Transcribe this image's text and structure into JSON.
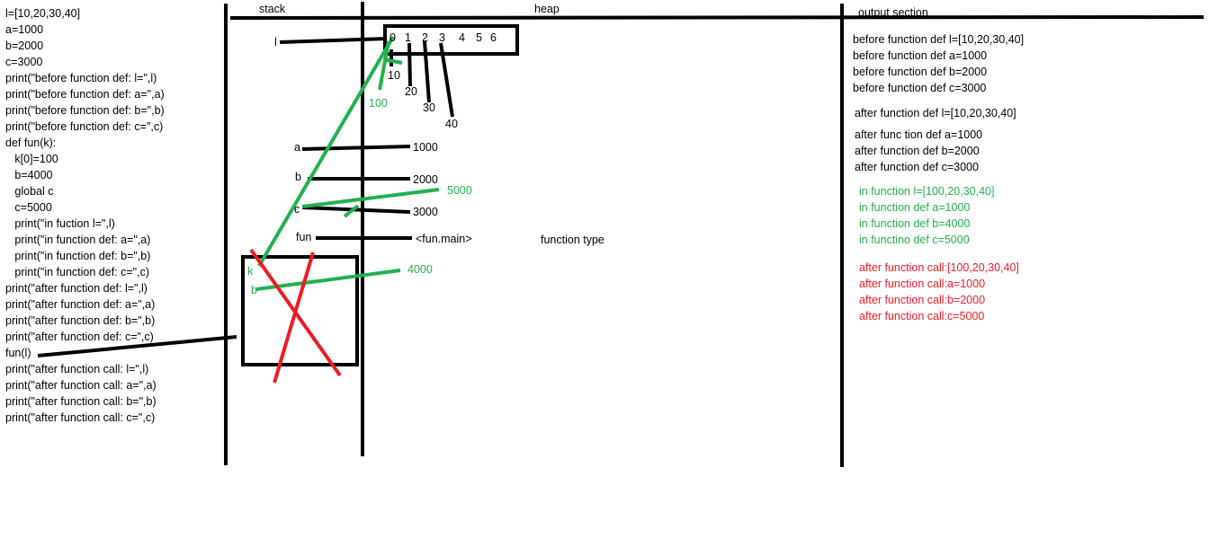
{
  "code_lines": [
    "l=[10,20,30,40]",
    "a=1000",
    "b=2000",
    "c=3000",
    "print(\"before function def: l=\",l)",
    "print(\"before function def: a=\",a)",
    "print(\"before function def: b=\",b)",
    "print(\"before function def: c=\",c)",
    "def fun(k):",
    "   k[0]=100",
    "   b=4000",
    "   global c",
    "   c=5000",
    "   print(\"in fuction l=\",l)",
    "   print(\"in function def: a=\",a)",
    "   print(\"in function def: b=\",b)",
    "   print(\"in function def: c=\",c)",
    "print(\"after function def: l=\",l)",
    "print(\"after function def: a=\",a)",
    "print(\"after function def: b=\",b)",
    "print(\"after function def: c=\",c)",
    "fun(l)",
    "print(\"after function call: l=\",l)",
    "print(\"after function call: a=\",a)",
    "print(\"after function call: b=\",b)",
    "print(\"after function call: c=\",c)"
  ],
  "headers": {
    "stack": "stack",
    "heap": "heap",
    "output": "output section"
  },
  "stack": {
    "l": "l",
    "a": "a",
    "b": "b",
    "c": "c",
    "fun": "fun",
    "k": "k",
    "b_local": "b"
  },
  "heap": {
    "indices": [
      "0",
      "1",
      "2",
      "3",
      "4",
      "5",
      "6"
    ],
    "values": [
      "10",
      "20",
      "30",
      "40"
    ],
    "new_first": "100",
    "a_val": "1000",
    "b_val": "2000",
    "c_val": "3000",
    "c_new": "5000",
    "fun_obj": "<fun.main>",
    "b_local_val": "4000",
    "function_type": "function type"
  },
  "output": {
    "before": [
      "before function def l=[10,20,30,40]",
      "before function def a=1000",
      "before function def b=2000",
      "before function def c=3000"
    ],
    "after_def_l": "after function def l=[10,20,30,40]",
    "after_def": [
      "after func tion def a=1000",
      "after function def b=2000",
      "after function def c=3000"
    ],
    "in_function": [
      "in function l=[100,20,30,40]",
      "in function def a=1000",
      "in function def b=4000",
      "in functino def c=5000"
    ],
    "after_call": [
      "after function call:[100,20,30,40]",
      "after function call:a=1000",
      "after function call:b=2000",
      "after function call:c=5000"
    ]
  },
  "colors": {
    "ink": "#000000",
    "changed": "#22b14c",
    "after_call": "#ed1c24"
  }
}
